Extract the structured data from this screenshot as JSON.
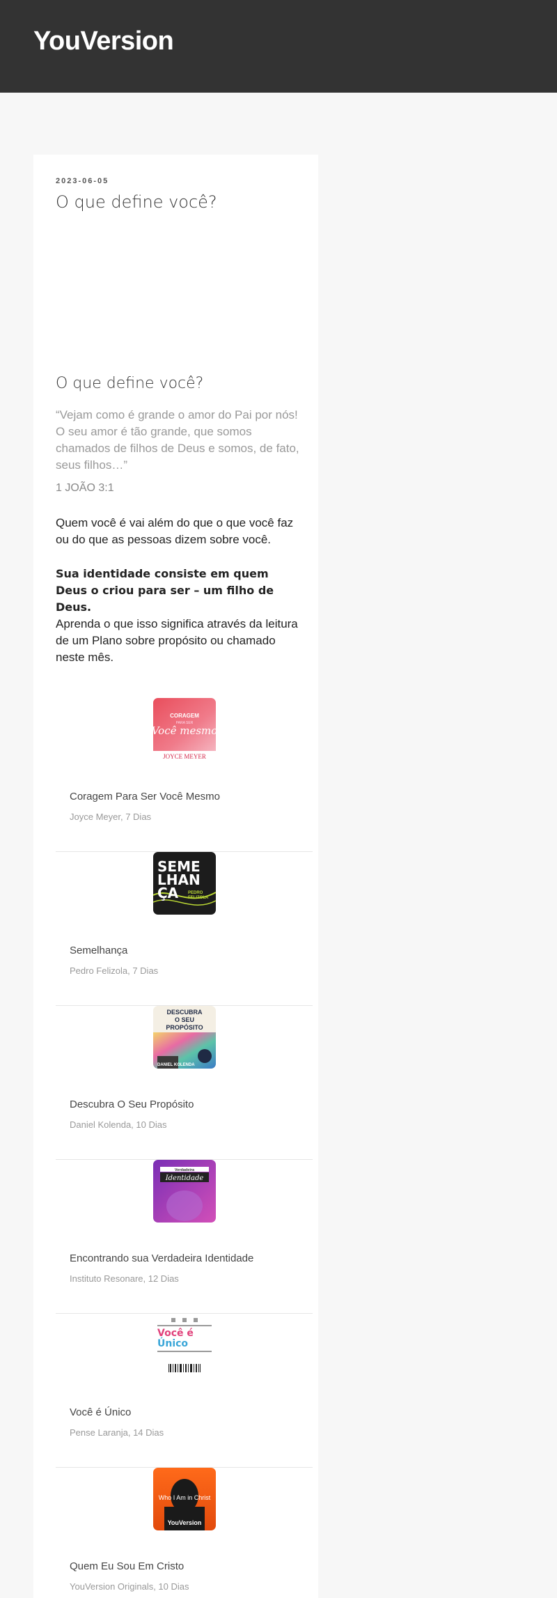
{
  "header": {
    "site_title": "YouVersion"
  },
  "post": {
    "date": "2023-06-05",
    "title": "O que define você?",
    "subtitle": "O que define você?",
    "quote": "“Vejam como é grande o amor do Pai por nós! O seu amor é tão grande, que somos chamados de filhos de Deus e somos, de fato, seus filhos…”",
    "reference": "1 JOÃO 3:1",
    "paragraph_1": "Quem você é vai além do que o que você faz ou do que as pessoas dizem sobre você.",
    "paragraph_2": "Sua identidade consiste em quem Deus o criou para ser – um filho de Deus.",
    "paragraph_3": "Aprenda o que isso significa através da leitura de um Plano sobre propósito ou chamado neste mês."
  },
  "plans": [
    {
      "title": "Coragem Para Ser Você Mesmo",
      "meta": "Joyce Meyer, 7 Dias",
      "thumb_text": [
        "CORAGEM",
        "PARA SER",
        "Você mesmo",
        "JOYCE MEYER"
      ]
    },
    {
      "title": "Semelhança",
      "meta": "Pedro Felizola, 7 Dias",
      "thumb_text": [
        "SEME",
        "LHAN",
        "ÇA",
        "PEDRO",
        "FELIZOLA"
      ]
    },
    {
      "title": "Descubra O Seu Propósito",
      "meta": "Daniel Kolenda, 10 Dias",
      "thumb_text": [
        "DESCUBRA",
        "O SEU",
        "PROPÓSITO",
        "DANIEL KOLENDA"
      ]
    },
    {
      "title": "Encontrando sua Verdadeira Identidade",
      "meta": "Instituto Resonare, 12 Dias",
      "thumb_text": [
        "Verdadeira",
        "Identidade"
      ]
    },
    {
      "title": "Você é Único",
      "meta": "Pense Laranja, 14 Dias",
      "thumb_text": [
        "Você é",
        "Único"
      ]
    },
    {
      "title": "Quem Eu Sou Em Cristo",
      "meta": "YouVersion Originals, 10 Dias",
      "thumb_text": [
        "Who I Am in Christ",
        "YouVersion"
      ]
    }
  ],
  "colors": {
    "header_bg": "#333333",
    "page_bg": "#f7f7f7",
    "card_bg": "#ffffff"
  }
}
